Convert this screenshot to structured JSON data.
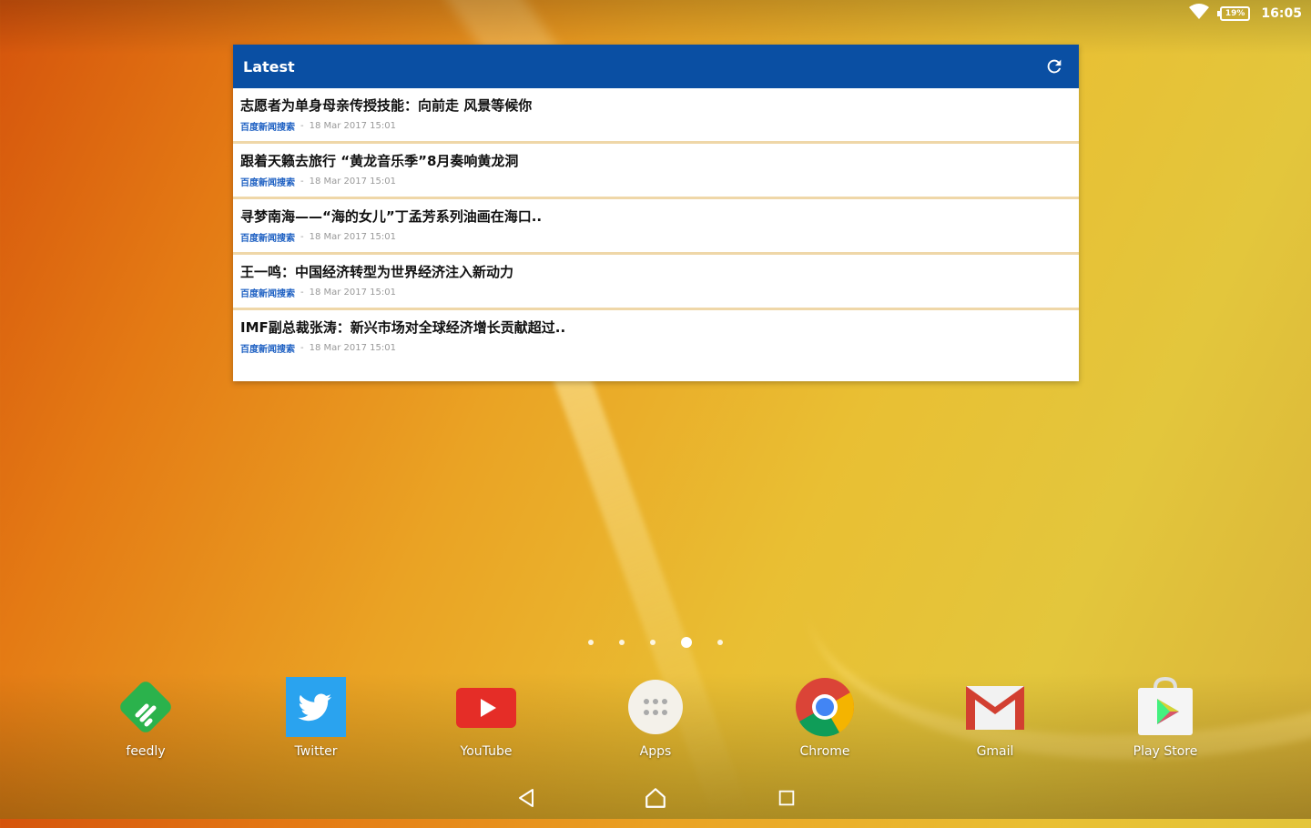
{
  "status_bar": {
    "battery": "19%",
    "time": "16:05",
    "wifi_icon": "wifi-icon"
  },
  "widget": {
    "title": "Latest",
    "refresh_icon": "refresh-icon",
    "items": [
      {
        "title": "志愿者为单身母亲传授技能：向前走 风景等候你",
        "source": "百度新闻搜索",
        "sep": "-",
        "date": "18 Mar 2017 15:01"
      },
      {
        "title": "跟着天籁去旅行 “黄龙音乐季”8月奏响黄龙洞",
        "source": "百度新闻搜索",
        "sep": "-",
        "date": "18 Mar 2017 15:01"
      },
      {
        "title": "寻梦南海——“海的女儿”丁孟芳系列油画在海口..",
        "source": "百度新闻搜索",
        "sep": "-",
        "date": "18 Mar 2017 15:01"
      },
      {
        "title": "王一鸣：中国经济转型为世界经济注入新动力",
        "source": "百度新闻搜索",
        "sep": "-",
        "date": "18 Mar 2017 15:01"
      },
      {
        "title": "IMF副总裁张涛：新兴市场对全球经济增长贡献超过..",
        "source": "百度新闻搜索",
        "sep": "-",
        "date": "18 Mar 2017 15:01"
      }
    ]
  },
  "pager": {
    "count": 5,
    "active_index": 3
  },
  "dock": {
    "apps": [
      {
        "label": "feedly",
        "icon": "feedly-icon"
      },
      {
        "label": "Twitter",
        "icon": "twitter-icon"
      },
      {
        "label": "YouTube",
        "icon": "youtube-icon"
      },
      {
        "label": "Apps",
        "icon": "apps-drawer-icon"
      },
      {
        "label": "Chrome",
        "icon": "chrome-icon"
      },
      {
        "label": "Gmail",
        "icon": "gmail-icon"
      },
      {
        "label": "Play Store",
        "icon": "play-store-icon"
      }
    ]
  },
  "navbar": {
    "back_icon": "back-icon",
    "home_icon": "home-icon",
    "recents_icon": "recents-icon"
  },
  "colors": {
    "widget_header": "#0a4fa3",
    "row_divider": "#efd7a8",
    "source_link": "#1c5fc2"
  }
}
